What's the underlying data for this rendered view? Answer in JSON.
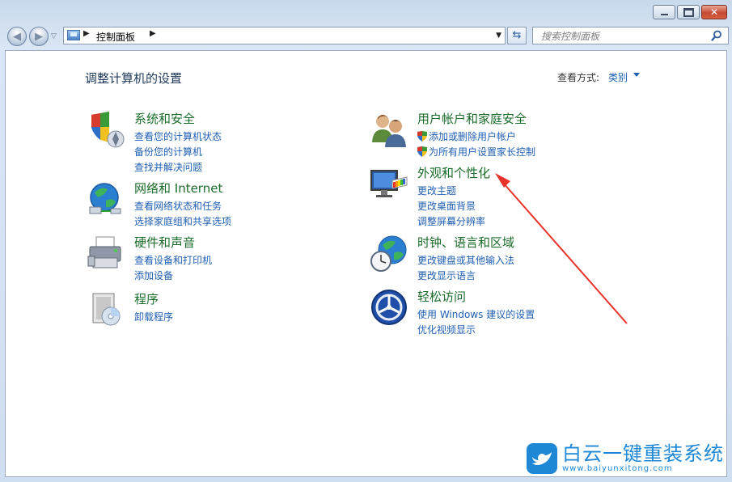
{
  "address_bar": {
    "crumb": "控制面板"
  },
  "search": {
    "placeholder": "搜索控制面板"
  },
  "header": {
    "title": "调整计算机的设置",
    "view_by_label": "查看方式:",
    "view_by_value": "类别"
  },
  "categories": [
    {
      "title": "系统和安全",
      "icon": "shield-security-icon",
      "links": [
        "查看您的计算机状态",
        "备份您的计算机",
        "查找并解决问题"
      ]
    },
    {
      "title": "网络和 Internet",
      "icon": "network-globe-icon",
      "links": [
        "查看网络状态和任务",
        "选择家庭组和共享选项"
      ]
    },
    {
      "title": "硬件和声音",
      "icon": "printer-icon",
      "links": [
        "查看设备和打印机",
        "添加设备"
      ]
    },
    {
      "title": "程序",
      "icon": "programs-box-icon",
      "links": [
        "卸载程序"
      ]
    },
    {
      "title": "用户帐户和家庭安全",
      "icon": "users-icon",
      "links": [
        "添加或删除用户帐户",
        "为所有用户设置家长控制"
      ]
    },
    {
      "title": "外观和个性化",
      "icon": "monitor-palette-icon",
      "links": [
        "更改主题",
        "更改桌面背景",
        "调整屏幕分辨率"
      ]
    },
    {
      "title": "时钟、语言和区域",
      "icon": "clock-globe-icon",
      "links": [
        "更改键盘或其他输入法",
        "更改显示语言"
      ]
    },
    {
      "title": "轻松访问",
      "icon": "ease-of-access-icon",
      "links": [
        "使用 Windows 建议的设置",
        "优化视频显示"
      ]
    }
  ],
  "colors": {
    "category_title": "#1a6c2a",
    "link": "#1f5fb3",
    "arrow": "#e8332a",
    "watermark": "#1e88d6"
  },
  "watermark": {
    "brand": "白云一键重装系统",
    "url": "www.baiyunxitong.com"
  }
}
